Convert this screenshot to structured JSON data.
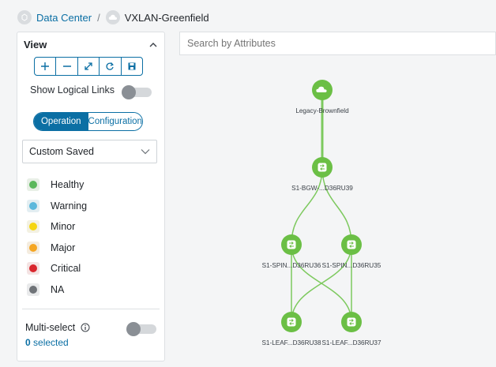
{
  "breadcrumb": {
    "root_label": "Data Center",
    "separator": "/",
    "current_label": "VXLAN-Greenfield"
  },
  "view_panel": {
    "title": "View",
    "toolbar": [
      {
        "name": "zoom-in-icon",
        "icon": "plus"
      },
      {
        "name": "zoom-out-icon",
        "icon": "minus"
      },
      {
        "name": "fit-to-screen-icon",
        "icon": "diagonal-arrows"
      },
      {
        "name": "refresh-icon",
        "icon": "circular-arrow"
      },
      {
        "name": "save-layout-icon",
        "icon": "floppy-disk"
      }
    ],
    "show_logical_links_label": "Show Logical Links",
    "show_logical_links": false,
    "mode_tabs": {
      "operation": "Operation",
      "configuration": "Configuration",
      "active": "operation"
    },
    "layout_dropdown": {
      "selected": "Custom Saved"
    },
    "legend": [
      {
        "label": "Healthy",
        "color": "#5cb85c",
        "bg": "#e8efe6"
      },
      {
        "label": "Warning",
        "color": "#5bb8dc",
        "bg": "#e3eef2"
      },
      {
        "label": "Minor",
        "color": "#f5d50f",
        "bg": "#f3f1e2"
      },
      {
        "label": "Major",
        "color": "#f5a623",
        "bg": "#f4ecdf"
      },
      {
        "label": "Critical",
        "color": "#d9262d",
        "bg": "#f4e3e3"
      },
      {
        "label": "NA",
        "color": "#6f7378",
        "bg": "#e9eaeb"
      }
    ],
    "multiselect_label": "Multi-select",
    "multiselect_enabled": false,
    "selected_count": "0",
    "selected_suffix": " selected"
  },
  "search": {
    "placeholder": "Search by Attributes"
  },
  "topology": {
    "node_color": "#6bbf45",
    "link_color": "#7dc95e",
    "nodes": [
      {
        "id": "cloud",
        "label": "Legacy-Brownfield",
        "icon": "cloud-icon"
      },
      {
        "id": "bgw",
        "label": "S1-BGW-...D36RU39",
        "icon": "switch-icon"
      },
      {
        "id": "spine1",
        "label": "S1-SPIN...D36RU36",
        "icon": "switch-icon"
      },
      {
        "id": "spine2",
        "label": "S1-SPIN...D36RU35",
        "icon": "switch-icon"
      },
      {
        "id": "leaf1",
        "label": "S1-LEAF...D36RU38",
        "icon": "switch-icon"
      },
      {
        "id": "leaf2",
        "label": "S1-LEAF...D36RU37",
        "icon": "switch-icon"
      }
    ],
    "links": [
      {
        "from": "cloud",
        "to": "bgw"
      },
      {
        "from": "bgw",
        "to": "spine1"
      },
      {
        "from": "bgw",
        "to": "spine2"
      },
      {
        "from": "spine1",
        "to": "leaf1"
      },
      {
        "from": "spine1",
        "to": "leaf2"
      },
      {
        "from": "spine2",
        "to": "leaf1"
      },
      {
        "from": "spine2",
        "to": "leaf2"
      }
    ]
  }
}
